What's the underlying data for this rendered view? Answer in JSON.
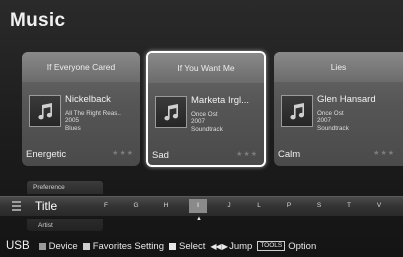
{
  "page": {
    "title": "Music"
  },
  "cards": [
    {
      "song": "If Everyone Cared",
      "artist": "Nickelback",
      "album": "All The Right Reas..",
      "year": "2005",
      "genre": "Blues",
      "mood": "Energetic",
      "rating": "★★★"
    },
    {
      "song": "If You Want Me",
      "artist": "Marketa Irgl...",
      "album": "Once Ost",
      "year": "2007",
      "genre": "Soundtrack",
      "mood": "Sad",
      "rating": "★★★"
    },
    {
      "song": "Lies",
      "artist": "Glen Hansard",
      "album": "Once Ost",
      "year": "2007",
      "genre": "Soundtrack",
      "mood": "Calm",
      "rating": "★★★"
    }
  ],
  "sort": {
    "above": "Preference",
    "current": "Title",
    "below": "Artist",
    "letters": [
      "F",
      "G",
      "H",
      "I",
      "J",
      "L",
      "P",
      "S",
      "T",
      "V"
    ],
    "selected_letter": "I",
    "pointer": "▲"
  },
  "help": {
    "source": "USB",
    "device": "Device",
    "favorites": "Favorites Setting",
    "select": "Select",
    "jump_arrows": "◀◀ ▶",
    "jump": "Jump",
    "tools_key": "TOOLS",
    "option": "Option"
  },
  "icons": {
    "album_art": "music-note-icon",
    "sort": "list-sort-icon"
  }
}
